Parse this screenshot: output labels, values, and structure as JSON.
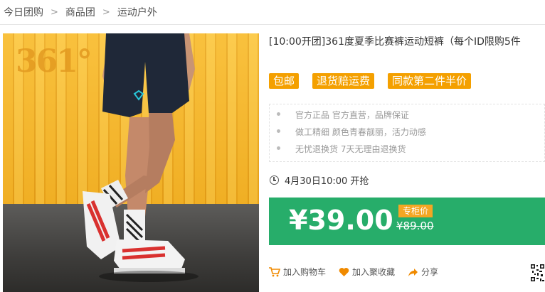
{
  "breadcrumb": {
    "items": [
      "今日团购",
      "商品团",
      "运动户外"
    ]
  },
  "product": {
    "title": "[10:00开团]361度夏季比赛裤运动短裤（每个ID限购5件",
    "image_logo": "361°"
  },
  "badges": [
    "包邮",
    "退货赔运费",
    "同款第二件半价"
  ],
  "features": [
    "官方正品 官方直营，品牌保证",
    "做工精细 颜色青春靓丽，活力动感",
    "无忧退换货 7天无理由退换货"
  ],
  "time": {
    "text": "4月30日10:00 开抢",
    "icon": "clock-icon"
  },
  "price": {
    "current": "¥39.00",
    "tag": "专柜价",
    "original": "¥89.00"
  },
  "actions": {
    "cart": "加入购物车",
    "favorite": "加入聚收藏",
    "share": "分享"
  },
  "colors": {
    "accent_orange": "#f4a000",
    "price_green": "#27ad6a",
    "tag_orange": "#f5a623"
  }
}
